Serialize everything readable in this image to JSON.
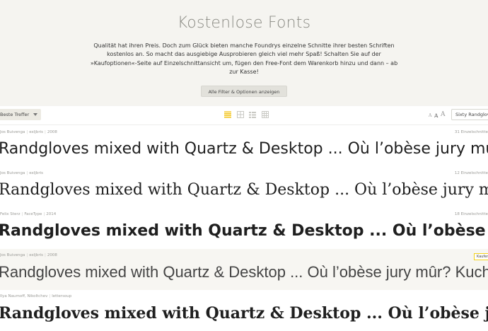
{
  "hero": {
    "title": "Kostenlose Fonts",
    "description_lines": [
      "Qualität hat ihren Preis. Doch zum Glück bieten manche Foundrys einzelne Schnitte ihrer besten Schriften",
      "kostenlos an. So macht das ausgiebige Ausprobieren gleich viel mehr Spaß! Schalten Sie auf der",
      "»Kaufoptionen«-Seite auf Einzelschnittansicht um, fügen den Free-Font dem Warenkorb hinzu und dann – ab",
      "zur Kasse!"
    ],
    "filter_button_label": "Alle Filter & Optionen anzeigen"
  },
  "toolbar": {
    "sort_label": "Beste Treffer",
    "view_icons": [
      "list-view-icon",
      "grid-view-icon",
      "compact-list-icon",
      "tile-view-icon"
    ],
    "size_labels": [
      "A",
      "A",
      "A"
    ],
    "sample_text_value": "Sixty Randgloves",
    "accent_color": "#f3d21a"
  },
  "sample_text": "Randgloves mixed with Quartz & Desktop ... Où l’obèse jury mûr? Kuchen",
  "fonts": [
    {
      "designer": "Jos Buivenga",
      "foundry": "exljbris",
      "year": "2008",
      "count": "31 Einzelschnitte"
    },
    {
      "designer": "Jos Buivenga",
      "foundry": "exljbris",
      "count": "12 Einzelschnitte"
    },
    {
      "designer": "Felix Sterz",
      "foundry": "FaceType",
      "year": "2014",
      "count": "18 Einzelschnitte"
    },
    {
      "designer": "Jos Buivenga",
      "foundry": "exljbris",
      "year": "2008",
      "badge": "Kaufen"
    },
    {
      "designer": "Ilya Naumoff, Nikoltchev",
      "foundry": "lettersoup"
    }
  ]
}
